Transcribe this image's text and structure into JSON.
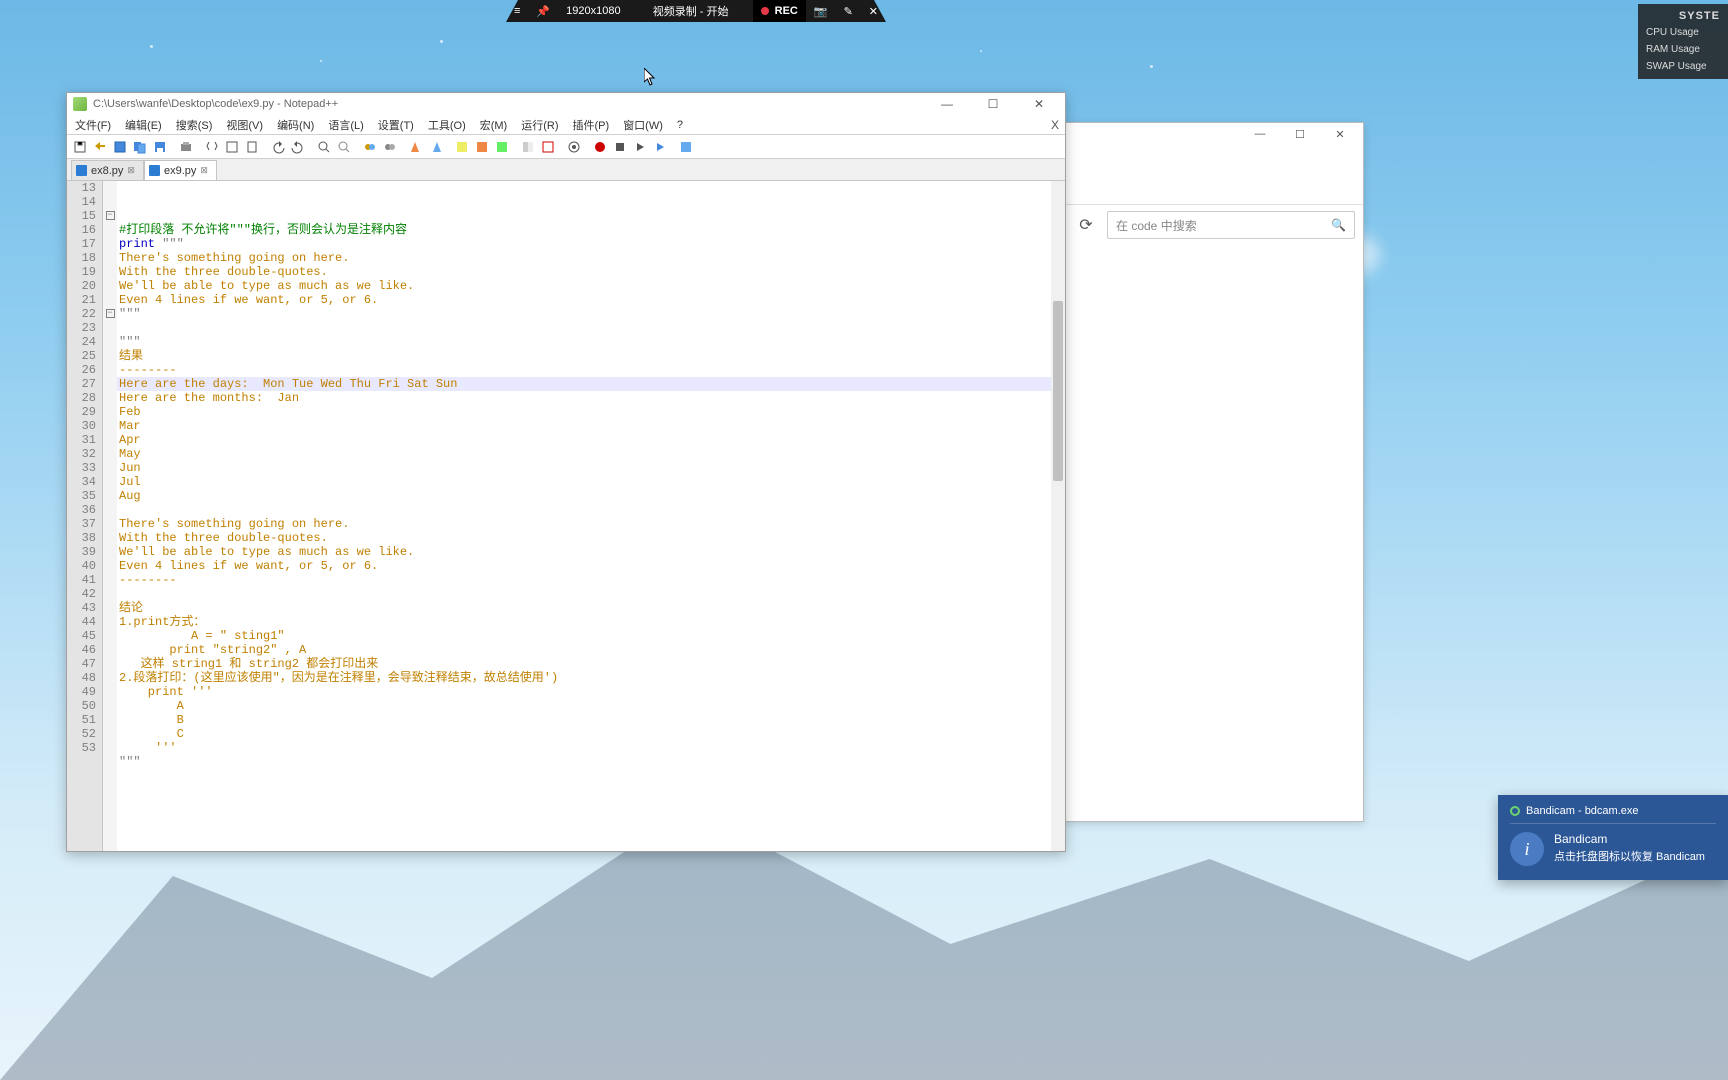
{
  "bandicam_bar": {
    "resolution": "1920x1080",
    "status": "视频录制 - 开始",
    "rec_label": "REC"
  },
  "sys_panel": {
    "title": "SYSTE",
    "rows": [
      "CPU Usage",
      "RAM Usage",
      "SWAP Usage"
    ]
  },
  "npp": {
    "title": "C:\\Users\\wanfe\\Desktop\\code\\ex9.py - Notepad++",
    "menu": [
      "文件(F)",
      "编辑(E)",
      "搜索(S)",
      "视图(V)",
      "编码(N)",
      "语言(L)",
      "设置(T)",
      "工具(O)",
      "宏(M)",
      "运行(R)",
      "插件(P)",
      "窗口(W)",
      "?"
    ],
    "tabs": [
      {
        "label": "ex8.py",
        "active": false
      },
      {
        "label": "ex9.py",
        "active": true
      }
    ],
    "line_start": 13,
    "highlighted_line": 25,
    "code_lines": [
      {
        "n": 13,
        "cls": "",
        "txt": ""
      },
      {
        "n": 14,
        "cls": "c-green",
        "txt": "#打印段落 不允许将\"\"\"换行，否则会认为是注释内容"
      },
      {
        "n": 15,
        "cls": "",
        "txt": "",
        "mixed": [
          {
            "c": "c-blue",
            "t": "print"
          },
          {
            "c": "c-gray",
            "t": " \"\"\""
          }
        ],
        "fold": "-"
      },
      {
        "n": 16,
        "cls": "c-orange",
        "txt": "There's something going on here."
      },
      {
        "n": 17,
        "cls": "c-orange",
        "txt": "With the three double-quotes."
      },
      {
        "n": 18,
        "cls": "c-orange",
        "txt": "We'll be able to type as much as we like."
      },
      {
        "n": 19,
        "cls": "c-orange",
        "txt": "Even 4 lines if we want, or 5, or 6."
      },
      {
        "n": 20,
        "cls": "c-gray",
        "txt": "\"\"\""
      },
      {
        "n": 21,
        "cls": "",
        "txt": ""
      },
      {
        "n": 22,
        "cls": "c-gray",
        "txt": "\"\"\"",
        "fold": "-"
      },
      {
        "n": 23,
        "cls": "c-orange",
        "txt": "结果"
      },
      {
        "n": 24,
        "cls": "c-orange",
        "txt": "--------"
      },
      {
        "n": 25,
        "cls": "c-orange",
        "txt": "Here are the days:  Mon Tue Wed Thu Fri Sat Sun"
      },
      {
        "n": 26,
        "cls": "c-orange",
        "txt": "Here are the months:  Jan"
      },
      {
        "n": 27,
        "cls": "c-orange",
        "txt": "Feb"
      },
      {
        "n": 28,
        "cls": "c-orange",
        "txt": "Mar"
      },
      {
        "n": 29,
        "cls": "c-orange",
        "txt": "Apr"
      },
      {
        "n": 30,
        "cls": "c-orange",
        "txt": "May"
      },
      {
        "n": 31,
        "cls": "c-orange",
        "txt": "Jun"
      },
      {
        "n": 32,
        "cls": "c-orange",
        "txt": "Jul"
      },
      {
        "n": 33,
        "cls": "c-orange",
        "txt": "Aug"
      },
      {
        "n": 34,
        "cls": "",
        "txt": ""
      },
      {
        "n": 35,
        "cls": "c-orange",
        "txt": "There's something going on here."
      },
      {
        "n": 36,
        "cls": "c-orange",
        "txt": "With the three double-quotes."
      },
      {
        "n": 37,
        "cls": "c-orange",
        "txt": "We'll be able to type as much as we like."
      },
      {
        "n": 38,
        "cls": "c-orange",
        "txt": "Even 4 lines if we want, or 5, or 6."
      },
      {
        "n": 39,
        "cls": "c-orange",
        "txt": "--------"
      },
      {
        "n": 40,
        "cls": "",
        "txt": ""
      },
      {
        "n": 41,
        "cls": "c-orange",
        "txt": "结论"
      },
      {
        "n": 42,
        "cls": "c-orange",
        "txt": "1.print方式："
      },
      {
        "n": 43,
        "cls": "c-orange",
        "txt": "          A = \" sting1\""
      },
      {
        "n": 44,
        "cls": "c-orange",
        "txt": "       print \"string2\" , A"
      },
      {
        "n": 45,
        "cls": "c-orange",
        "txt": "   这样 string1 和 string2 都会打印出来"
      },
      {
        "n": 46,
        "cls": "c-orange",
        "txt": "2.段落打印：(这里应该使用\"，因为是在注释里，会导致注释结束，故总结使用')"
      },
      {
        "n": 47,
        "cls": "c-orange",
        "txt": "    print '''"
      },
      {
        "n": 48,
        "cls": "c-orange",
        "txt": "        A"
      },
      {
        "n": 49,
        "cls": "c-orange",
        "txt": "        B"
      },
      {
        "n": 50,
        "cls": "c-orange",
        "txt": "        C"
      },
      {
        "n": 51,
        "cls": "c-orange",
        "txt": "     '''"
      },
      {
        "n": 52,
        "cls": "c-gray",
        "txt": "\"\"\""
      },
      {
        "n": 53,
        "cls": "",
        "txt": ""
      }
    ]
  },
  "explorer": {
    "search_placeholder": "在 code 中搜索"
  },
  "notif": {
    "header": "Bandicam - bdcam.exe",
    "title": "Bandicam",
    "msg": "点击托盘图标以恢复 Bandicam"
  }
}
